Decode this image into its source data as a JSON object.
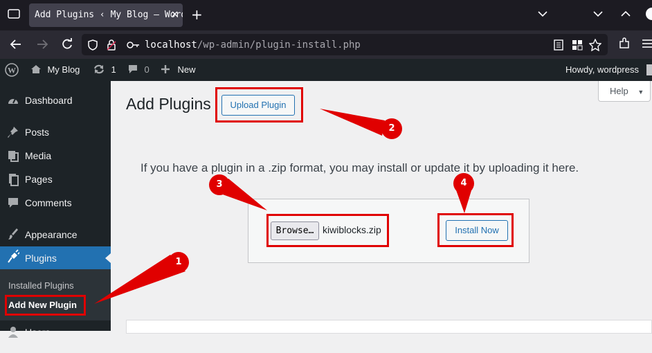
{
  "browser": {
    "tab_title": "Add Plugins ‹ My Blog — WordPress",
    "url_host": "localhost",
    "url_path": "/wp-admin/plugin-install.php",
    "icons": [
      "wordpress-logo-icon",
      "back-icon",
      "forward-icon",
      "reload-icon",
      "shield-icon",
      "lock-icon",
      "key-icon",
      "reader-icon",
      "grid-icon",
      "star-icon",
      "extensions-icon",
      "menu-icon"
    ]
  },
  "adminbar": {
    "site_name": "My Blog",
    "updates_count": "1",
    "comments_count": "0",
    "new_label": "New",
    "howdy": "Howdy, wordpress"
  },
  "sidebar": {
    "items": [
      {
        "label": "Dashboard",
        "icon": "dashboard-icon"
      },
      {
        "label": "Posts",
        "icon": "pin-icon"
      },
      {
        "label": "Media",
        "icon": "media-icon"
      },
      {
        "label": "Pages",
        "icon": "pages-icon"
      },
      {
        "label": "Comments",
        "icon": "comment-icon"
      },
      {
        "label": "Appearance",
        "icon": "brush-icon"
      },
      {
        "label": "Plugins",
        "icon": "plug-icon"
      },
      {
        "label": "Users",
        "icon": "users-icon"
      }
    ],
    "submenu": [
      "Installed Plugins",
      "Add New Plugin"
    ]
  },
  "main": {
    "title": "Add Plugins",
    "upload_button": "Upload Plugin",
    "help_label": "Help",
    "intro": "If you have a plugin in a .zip format, you may install or update it by uploading it here.",
    "browse_label": "Browse…",
    "filename": "kiwiblocks.zip",
    "install_button": "Install Now"
  },
  "annotations": {
    "markers": [
      "1",
      "2",
      "3",
      "4"
    ],
    "color": "#e00000"
  },
  "colors": {
    "accent": "#2271b1",
    "admin_dark": "#1d2327"
  }
}
